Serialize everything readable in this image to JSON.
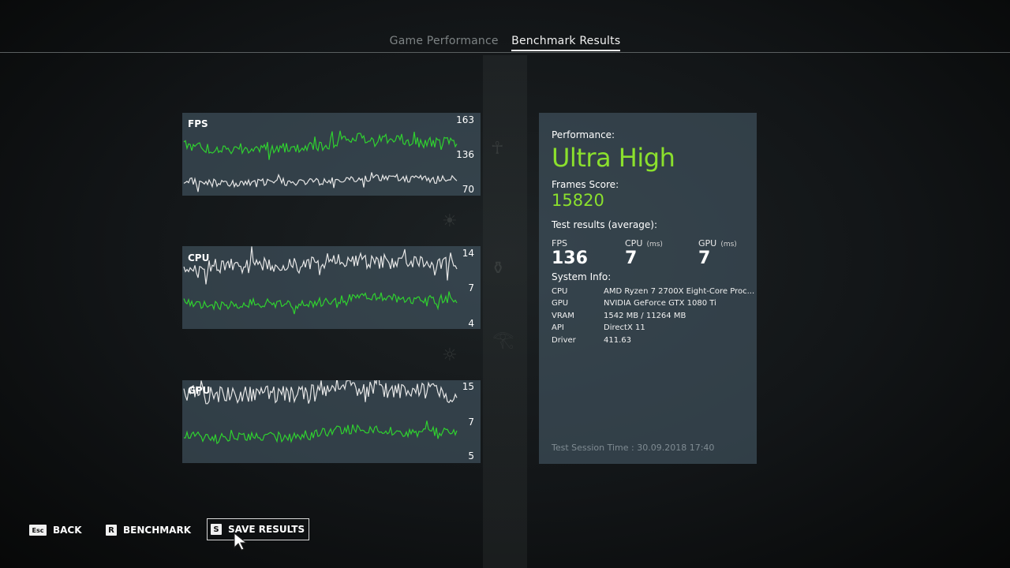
{
  "tabs": [
    {
      "label": "Game Performance",
      "active": false
    },
    {
      "label": "Benchmark Results",
      "active": true
    }
  ],
  "graphs": {
    "fps": {
      "label": "FPS",
      "ticks": [
        "163",
        "136",
        "70"
      ]
    },
    "cpu": {
      "label": "CPU",
      "ticks": [
        "14",
        "7",
        "4"
      ]
    },
    "gpu": {
      "label": "GPU",
      "ticks": [
        "15",
        "7",
        "5"
      ]
    }
  },
  "results": {
    "performance_label": "Performance:",
    "performance_value": "Ultra High",
    "frames_score_label": "Frames Score:",
    "frames_score_value": "15820",
    "test_results_label": "Test results (average):",
    "metrics": [
      {
        "label": "FPS",
        "unit": "",
        "value": "136"
      },
      {
        "label": "CPU",
        "unit": "(ms)",
        "value": "7"
      },
      {
        "label": "GPU",
        "unit": "(ms)",
        "value": "7"
      }
    ],
    "system_info_label": "System Info:",
    "system_info": [
      {
        "key": "CPU",
        "value": "AMD Ryzen 7 2700X Eight-Core Proc..."
      },
      {
        "key": "GPU",
        "value": "NVIDIA GeForce GTX 1080 Ti"
      },
      {
        "key": "VRAM",
        "value": "1542 MB / 11264 MB"
      },
      {
        "key": "API",
        "value": "DirectX 11"
      },
      {
        "key": "Driver",
        "value": "411.63"
      }
    ],
    "session_time": "Test Session Time : 30.09.2018 17:40"
  },
  "footer": [
    {
      "key": "Esc",
      "label": "BACK"
    },
    {
      "key": "R",
      "label": "BENCHMARK"
    },
    {
      "key": "S",
      "label": "SAVE RESULTS",
      "focused": true
    }
  ],
  "colors": {
    "accent_green": "#8be02d",
    "line_green": "#2fd12f",
    "line_white": "#e6e6e6"
  },
  "icons": [
    "mouse-cursor-icon"
  ]
}
